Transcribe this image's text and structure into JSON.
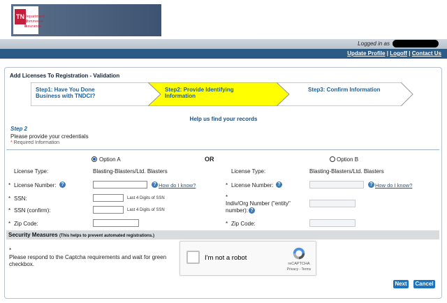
{
  "brand": {
    "logo_abbrev": "TN",
    "logo_line1": "Department of",
    "logo_line2": "Commerce &",
    "logo_line3": "Insurance"
  },
  "userbar": {
    "logged_in": "Logged in as"
  },
  "nav": {
    "update_profile": "Update Profile",
    "sep": " | ",
    "logoff": "Logoff",
    "contact_us": "Contact Us"
  },
  "page": {
    "title": "Add Licenses To Registration - Validation"
  },
  "steps": [
    {
      "label": "Step1: Have You Done Business with TNDCI?",
      "state": "done"
    },
    {
      "label": "Step2: Provide Identifying Information",
      "state": "current"
    },
    {
      "label": "Step3: Confirm Information",
      "state": "pending"
    }
  ],
  "form": {
    "heading": "Help us find your records",
    "step_label": "Step 2",
    "instruction": "Please provide your credentials",
    "required_note": "Required Information",
    "or_label": "OR",
    "option_a": {
      "label": "Option A",
      "selected": true,
      "license_type_label": "License Type:",
      "license_type_value": "Blasting-Blasters/Ltd. Blasters",
      "license_number_label": "License Number:",
      "how_do_i_know": "How do I know?",
      "ssn_label": "SSN:",
      "ssn_hint": "Last 4 Digits of SSN",
      "ssn_confirm_label": "SSN (confirm):",
      "ssn_confirm_hint": "Last 4 Digits of SSN",
      "zip_label": "Zip Code:"
    },
    "option_b": {
      "label": "Option B",
      "selected": false,
      "license_type_label": "License Type:",
      "license_type_value": "Blasting-Blasters/Ltd. Blasters",
      "license_number_label": "License Number:",
      "how_do_i_know": "How do I know?",
      "entity_label": "Indiv/Org Number (\"entity\" number):",
      "zip_label": "Zip Code:"
    }
  },
  "security": {
    "title": "Security Measures",
    "subtitle": "(This helps to prevent automated registrations.)",
    "note": "Please respond to the Captcha requirements and wait for green checkbox.",
    "captcha_text": "I'm not a robot",
    "captcha_brand": "reCAPTCHA",
    "captcha_terms": "Privacy - Terms"
  },
  "buttons": {
    "next": "Next",
    "cancel": "Cancel"
  },
  "colors": {
    "nav_bg": "#2c5b86",
    "current_step": "#ffff00",
    "link": "#1f5f97",
    "button": "#1e73be",
    "required": "#c0392b"
  }
}
